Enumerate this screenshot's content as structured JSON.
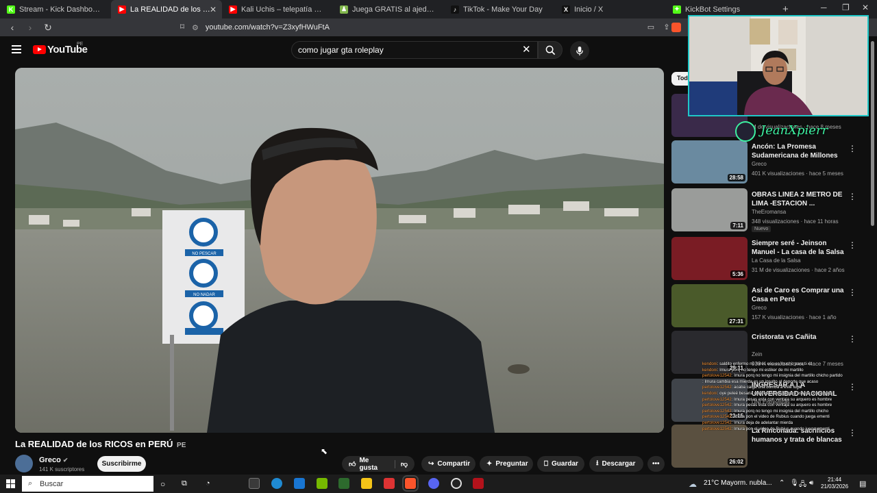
{
  "browser": {
    "tabs": [
      {
        "label": "Stream - Kick Dashboard",
        "fav_color": "#53fc18",
        "fav": "K",
        "active": false
      },
      {
        "label": "La REALIDAD de los RICOS e",
        "fav_color": "#ff0000",
        "fav": "▶",
        "active": true
      },
      {
        "label": "Kali Uchis – telepatía [Official Audio]",
        "fav_color": "#ff0000",
        "fav": "▶",
        "active": false
      },
      {
        "label": "Juega GRATIS al ajedrez online - Aje",
        "fav_color": "#81b64c",
        "fav": "♟",
        "active": false
      },
      {
        "label": "TikTok - Make Your Day",
        "fav_color": "#111111",
        "fav": "♪",
        "active": false
      },
      {
        "label": "Inicio / X",
        "fav_color": "#111111",
        "fav": "X",
        "active": false
      },
      {
        "label": "KickBot Settings",
        "fav_color": "#53fc18",
        "fav": "✦",
        "active": false
      }
    ],
    "url": "youtube.com/watch?v=Z3xyfHWuFtA"
  },
  "youtube": {
    "logo_text": "YouTube",
    "country": "PE",
    "search_value": "como jugar gta roleplay",
    "chip_label": "Tod"
  },
  "video": {
    "title": "La REALIDAD de los RICOS en PERÚ",
    "title_suffix": "PE",
    "channel": "Greco",
    "subscribers": "141 K suscriptores",
    "subscribe_label": "Suscribirme",
    "actions": {
      "like": "Me gusta",
      "share": "Compartir",
      "ask": "Preguntar",
      "save": "Guardar",
      "download": "Descargar"
    },
    "sign_texts": [
      "NO PESCAR",
      "NO NADAR"
    ]
  },
  "recommendations": [
    {
      "title": "",
      "channel": "",
      "meta": "M de visualizaciones · hace 8 meses",
      "duration": "",
      "thumb": "#3a2a4a",
      "badge": ""
    },
    {
      "title": "Ancón: La Promesa Sudamericana de Millones de ...",
      "channel": "Greco",
      "meta": "401 K visualizaciones · hace 5 meses",
      "duration": "28:58",
      "thumb": "#6a8aa0",
      "badge": ""
    },
    {
      "title": "OBRAS LINEA 2 METRO DE LIMA -ESTACION ...",
      "channel": "TheEromansa",
      "meta": "348 visualizaciones · hace 11 horas",
      "duration": "7:11",
      "thumb": "#9a9c9a",
      "badge": "Nuevo"
    },
    {
      "title": "Siempre seré - Jeinson Manuel - La casa de la Salsa - 9 de Juni...",
      "channel": "La Casa de la Salsa",
      "meta": "31 M de visualizaciones · hace 2 años",
      "duration": "5:36",
      "thumb": "#7a1c24",
      "badge": ""
    },
    {
      "title": "Así de Caro es Comprar una Casa en Perú",
      "channel": "Greco",
      "meta": "157 K visualizaciones · hace 1 año",
      "duration": "27:31",
      "thumb": "#4a5a2a",
      "badge": ""
    },
    {
      "title": "Cristorata vs Cañita",
      "channel": "Zein",
      "meta": "938 K visualizaciones · hace 7 meses",
      "duration": "29:11",
      "thumb": "#2a2a2e",
      "badge": ""
    },
    {
      "title": "INGRESAR A LA UNIVERSIDAD NACIONAL DE INGENIERÍA ES ...",
      "channel": "UNI Entrevistas",
      "meta": "",
      "duration": "23:15",
      "thumb": "#40444a",
      "badge": ""
    },
    {
      "title": "La Rinconada: sacrificios humanos y trata de blancas",
      "channel": "",
      "meta": "",
      "duration": "26:02",
      "thumb": "#5a5040",
      "badge": ""
    }
  ],
  "overlay": {
    "streamer_name": "JeanXpierr",
    "chat": [
      {
        "user": "kendoni",
        "msg": "saldito enfermo no mires eso es mucho para ti xd"
      },
      {
        "user": "kendoni",
        "msg": "Imura porq no tengo mi estiker de mi martillo"
      },
      {
        "user": "pertolove12542",
        "msg": "Imura porq no tengo mi insignia del martillo chicho partido"
      },
      {
        "user": "",
        "msg": "Imura cambia esa mierda es un insulto al deporte que acaso"
      },
      {
        "user": "pertolove12542",
        "msg": "acaba caiga una bomba a este lugar"
      },
      {
        "user": "kendoni",
        "msg": "oye peleé besaria quieres veroos seguro estaria con la goldi"
      },
      {
        "user": "pertolove12542",
        "msg": "Imura pesas esta con ventaja su arquero es hombre"
      },
      {
        "user": "pertolove12542",
        "msg": "Imura pesas esta con ventaja su arquero es hombre"
      },
      {
        "user": "pertolove12542",
        "msg": "Imura porq no tengo mi insignia del martillo chicho"
      },
      {
        "user": "pertolove12542",
        "msg": "Imura pon el video de Rubius cuando juega ementi"
      },
      {
        "user": "pertolove12542",
        "msg": "Imura deja de adelantar mierda"
      },
      {
        "user": "pertolove12542",
        "msg": "Imura pon el video de Rubius cuando juega ementi"
      }
    ]
  },
  "taskbar": {
    "search_placeholder": "Buscar",
    "weather": "21°C  Mayorm. nubla...",
    "time": "21:44",
    "date": "21/03/2026"
  }
}
